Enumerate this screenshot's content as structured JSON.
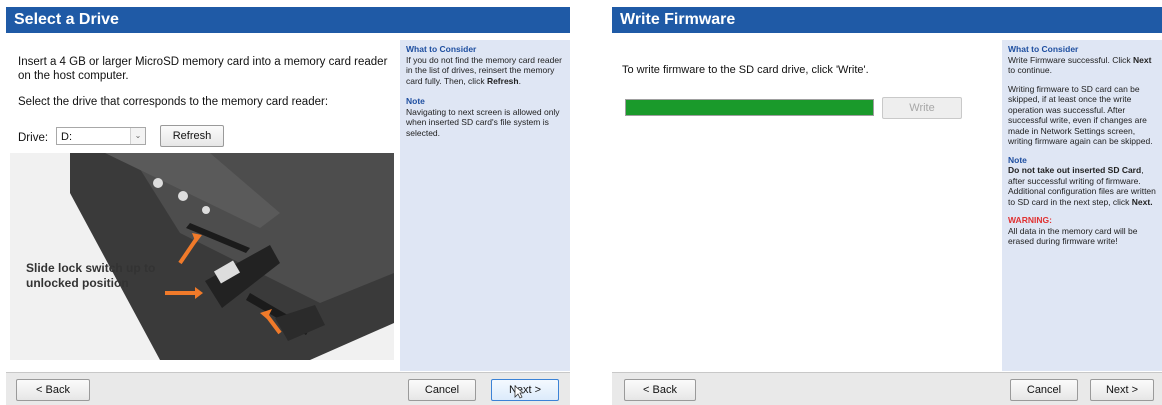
{
  "select_drive": {
    "title": "Select a Drive",
    "instruction_1": "Insert a 4 GB or larger MicroSD memory card into a memory card reader on the host computer.",
    "instruction_2": "Select the drive that corresponds to the memory card reader:",
    "drive_label": "Drive:",
    "drive_value": "D:",
    "refresh_label": "Refresh",
    "illustration_caption": "Slide lock switch up to unlocked position",
    "sidebar": {
      "consider_heading": "What to Consider",
      "consider_text_before": "If you do not find the memory card reader in the list of drives, reinsert the memory card fully. Then, click ",
      "consider_text_bold": "Refresh",
      "consider_text_after": ".",
      "note_heading": "Note",
      "note_text": "Navigating to next screen is allowed only when inserted SD card's file system is selected."
    },
    "footer": {
      "back_label": "< Back",
      "cancel_label": "Cancel",
      "next_label": "Next >"
    }
  },
  "write_firmware": {
    "title": "Write Firmware",
    "instruction": "To write firmware to the SD card drive, click 'Write'.",
    "progress_fraction": 1.0,
    "write_label": "Write",
    "sidebar": {
      "consider_heading": "What to Consider",
      "consider_text_before": "Write Firmware successful. Click ",
      "consider_text_bold": "Next",
      "consider_text_after": " to continue.",
      "skip_text": "Writing firmware to SD card can be skipped, if at least once the write operation was successful. After successful write, even if changes are made in Network Settings screen, writing firmware again can be skipped.",
      "note_heading": "Note",
      "note_bold": "Do not take out inserted SD Card",
      "note_text_1": ", after successful writing of firmware. Additional configuration files are written to SD card in the next step, click ",
      "note_bold_2": "Next.",
      "warning_heading": "WARNING:",
      "warning_text": "All data in the memory card will be erased during firmware write!"
    },
    "footer": {
      "back_label": "< Back",
      "cancel_label": "Cancel",
      "next_label": "Next >"
    }
  },
  "colors": {
    "title_bar": "#1f5aa6",
    "sidebar_bg": "#dfe6f4",
    "heading_blue": "#1f4fa0",
    "progress_green": "#1a9a2b",
    "warning_red": "#e03131",
    "arrow_orange": "#f07a2a"
  }
}
